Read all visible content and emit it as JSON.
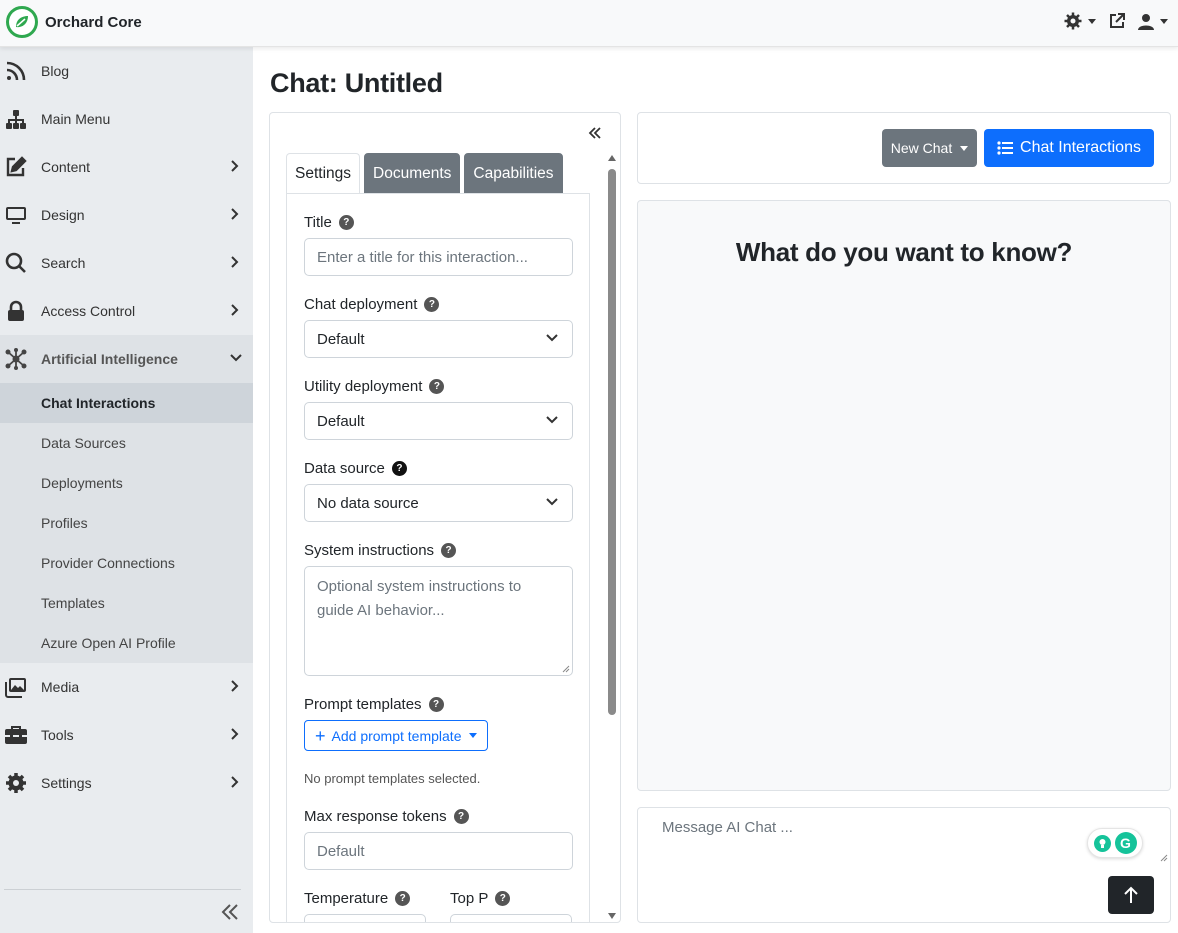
{
  "app": {
    "brand_name": "Orchard Core",
    "brand_color": "#2fa84f"
  },
  "topbar": {
    "icons": [
      "theme-gear-icon",
      "external-link-icon",
      "user-icon"
    ]
  },
  "sidebar": {
    "items": [
      {
        "label": "Blog",
        "icon": "rss-icon"
      },
      {
        "label": "Main Menu",
        "icon": "sitemap-icon"
      },
      {
        "label": "Content",
        "icon": "edit-icon"
      },
      {
        "label": "Design",
        "icon": "monitor-icon"
      },
      {
        "label": "Search",
        "icon": "search-icon"
      },
      {
        "label": "Access Control",
        "icon": "lock-icon"
      },
      {
        "label": "Artificial Intelligence",
        "icon": "network-icon"
      },
      {
        "label": "Media",
        "icon": "images-icon"
      },
      {
        "label": "Tools",
        "icon": "toolbox-icon"
      },
      {
        "label": "Settings",
        "icon": "gear-icon"
      }
    ],
    "ai_children": [
      {
        "label": "Chat Interactions",
        "active": true
      },
      {
        "label": "Data Sources"
      },
      {
        "label": "Deployments"
      },
      {
        "label": "Profiles"
      },
      {
        "label": "Provider Connections"
      },
      {
        "label": "Templates"
      },
      {
        "label": "Azure Open AI Profile"
      }
    ]
  },
  "page": {
    "title": "Chat: Untitled"
  },
  "settings_panel": {
    "tabs": [
      {
        "label": "Settings",
        "active": true
      },
      {
        "label": "Documents"
      },
      {
        "label": "Capabilities"
      }
    ],
    "title_label": "Title",
    "title_placeholder": "Enter a title for this interaction...",
    "chat_deployment_label": "Chat deployment",
    "chat_deployment_value": "Default",
    "utility_deployment_label": "Utility deployment",
    "utility_deployment_value": "Default",
    "data_source_label": "Data source",
    "data_source_value": "No data source",
    "system_instructions_label": "System instructions",
    "system_instructions_placeholder": "Optional system instructions to guide AI behavior...",
    "prompt_templates_label": "Prompt templates",
    "add_prompt_template_label": "Add prompt template",
    "no_templates_note": "No prompt templates selected.",
    "max_tokens_label": "Max response tokens",
    "max_tokens_placeholder": "Default",
    "temperature_label": "Temperature",
    "top_p_label": "Top P"
  },
  "chat": {
    "new_chat_label": "New Chat",
    "chat_interactions_label": "Chat Interactions",
    "heading": "What do you want to know?",
    "message_placeholder": "Message AI Chat ...",
    "primary_color": "#0d6efd",
    "secondary_color": "#6c757d"
  }
}
